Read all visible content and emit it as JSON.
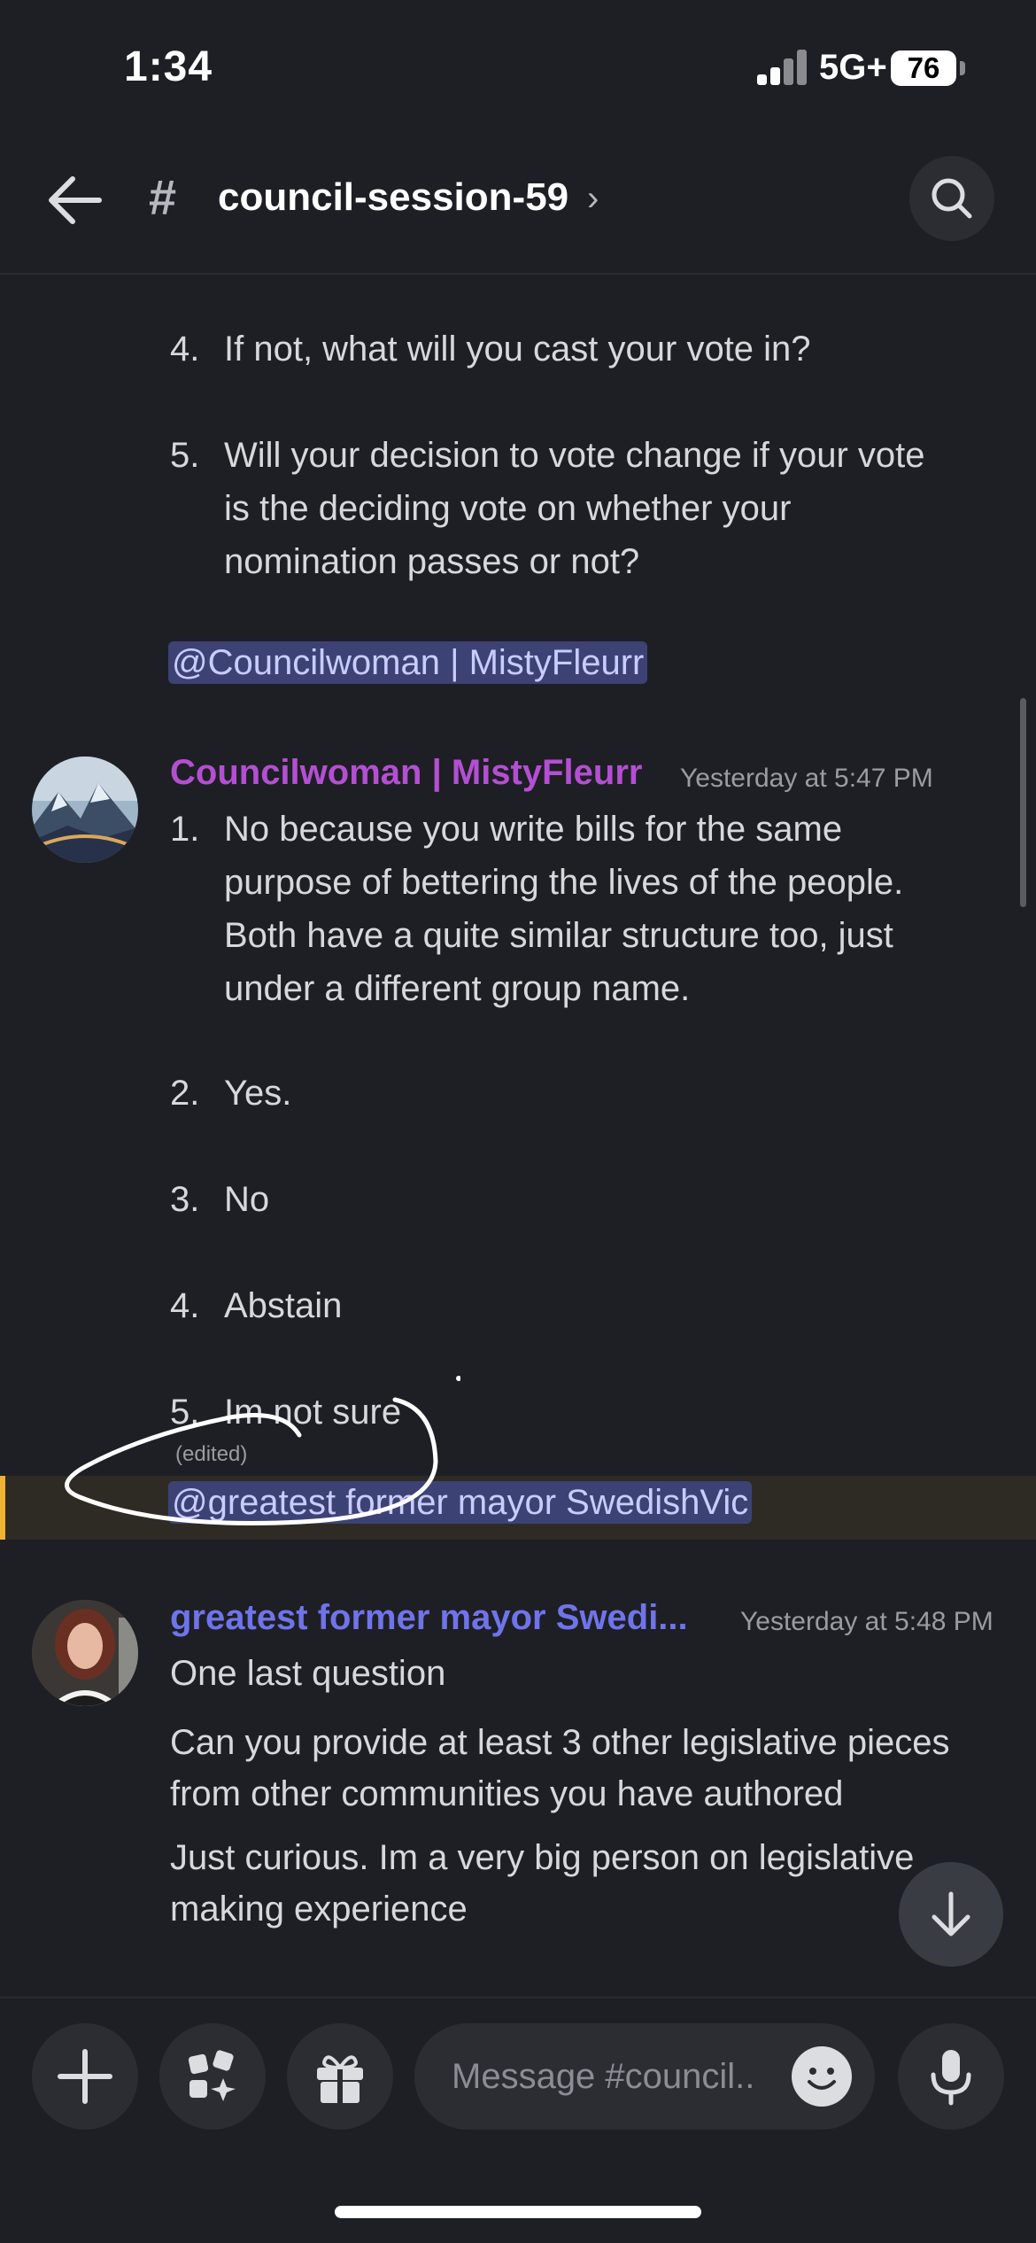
{
  "status_bar": {
    "time": "1:34",
    "network": "5G+",
    "battery": "76"
  },
  "header": {
    "channel_name": "council-session-59",
    "hash": "#",
    "chevron": "›"
  },
  "previous_message": {
    "items": [
      {
        "num": "4.",
        "lines": [
          "If not, what will you cast your vote in?"
        ]
      },
      {
        "num": "5.",
        "lines": [
          "Will your decision to vote change if your vote",
          "is the deciding vote on whether your",
          "nomination passes or not?"
        ]
      }
    ],
    "mention": "@Councilwoman | MistyFleurr"
  },
  "message_misty": {
    "username": "Councilwoman | MistyFleurr",
    "timestamp": "Yesterday at 5:47 PM",
    "items": [
      {
        "num": "1.",
        "lines": [
          "No because you write bills for the same",
          "purpose of bettering the lives of the people.",
          "Both have a quite similar structure too, just",
          "under a different group name."
        ]
      },
      {
        "num": "2.",
        "lines": [
          "Yes."
        ]
      },
      {
        "num": "3.",
        "lines": [
          "No"
        ]
      },
      {
        "num": "4.",
        "lines": [
          "Abstain"
        ]
      },
      {
        "num": "5.",
        "lines": [
          "Im not sure"
        ]
      }
    ],
    "edited": "(edited)",
    "mention": "@greatest former mayor SwedishVic"
  },
  "message_vic": {
    "username": "greatest former mayor Swedi...",
    "timestamp": "Yesterday at 5:48 PM",
    "texts": [
      "One last question",
      "Can you provide at least 3 other legislative pieces",
      "from other communities you have authored",
      "Just curious. Im a very big person on legislative",
      "making experience"
    ]
  },
  "composer": {
    "placeholder": "Message #council.."
  },
  "icons": [
    "back-arrow-icon",
    "search-icon",
    "plus-icon",
    "apps-icon",
    "gift-icon",
    "emoji-icon",
    "microphone-icon",
    "arrow-down-icon"
  ]
}
